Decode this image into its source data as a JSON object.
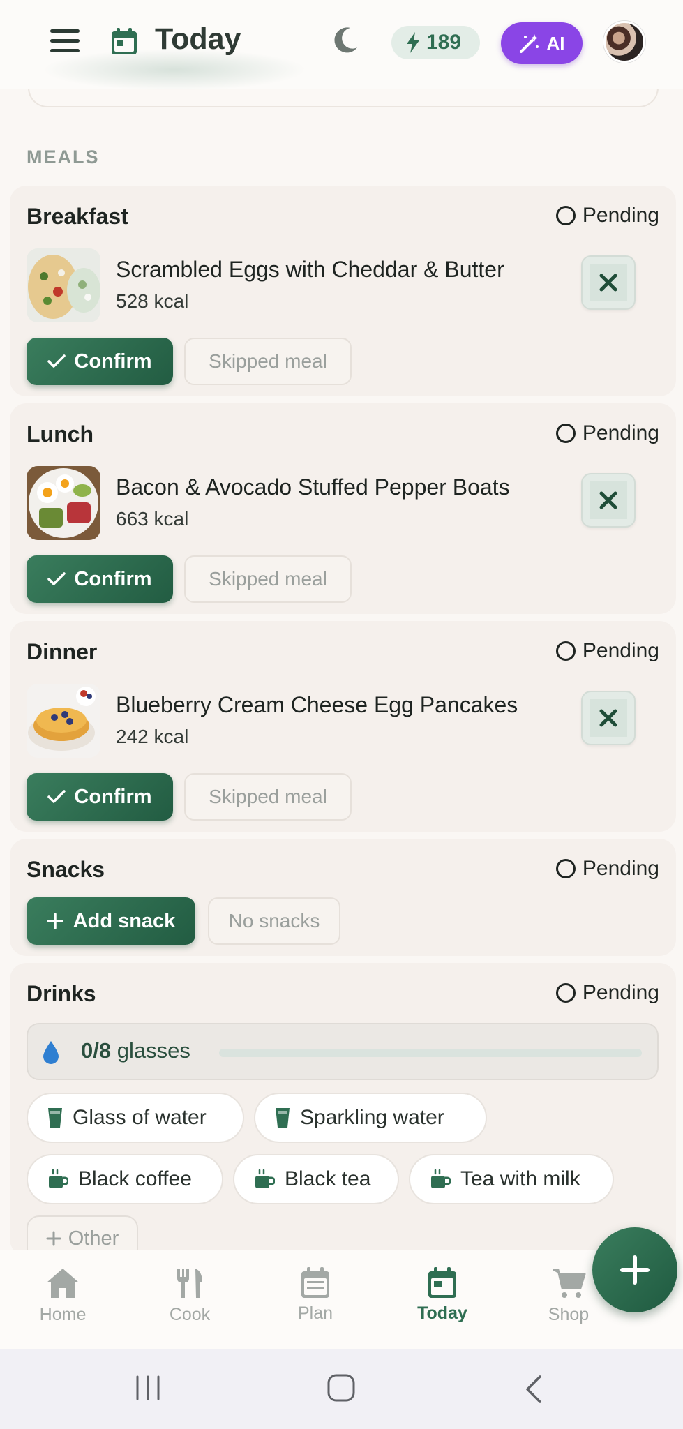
{
  "header": {
    "title": "Today",
    "energy_value": "189",
    "ai_label": "AI"
  },
  "section_label": "MEALS",
  "meals": [
    {
      "title": "Breakfast",
      "status": "Pending",
      "dish": "Scrambled Eggs with Cheddar & Butter",
      "kcal": "528 kcal",
      "confirm": "Confirm",
      "skip": "Skipped meal"
    },
    {
      "title": "Lunch",
      "status": "Pending",
      "dish": "Bacon & Avocado Stuffed Pepper Boats",
      "kcal": "663 kcal",
      "confirm": "Confirm",
      "skip": "Skipped meal"
    },
    {
      "title": "Dinner",
      "status": "Pending",
      "dish": "Blueberry Cream Cheese Egg Pancakes",
      "kcal": "242 kcal",
      "confirm": "Confirm",
      "skip": "Skipped meal"
    }
  ],
  "snacks": {
    "title": "Snacks",
    "status": "Pending",
    "add": "Add snack",
    "none": "No snacks"
  },
  "drinks": {
    "title": "Drinks",
    "status": "Pending",
    "water_count": "0/8",
    "water_unit": "glasses",
    "water_progress": 0,
    "options": [
      "Glass of water",
      "Sparkling water",
      "Black coffee",
      "Black tea",
      "Tea with milk"
    ],
    "other": "Other"
  },
  "nav": [
    {
      "label": "Home",
      "icon": "home-icon"
    },
    {
      "label": "Cook",
      "icon": "fork-knife-icon"
    },
    {
      "label": "Plan",
      "icon": "calendar-icon"
    },
    {
      "label": "Today",
      "icon": "calendar-icon",
      "active": true
    },
    {
      "label": "Shop",
      "icon": "cart-icon"
    }
  ],
  "colors": {
    "primary": "#2f6e52",
    "ai": "#8a45e6",
    "background": "#faf7f4"
  }
}
